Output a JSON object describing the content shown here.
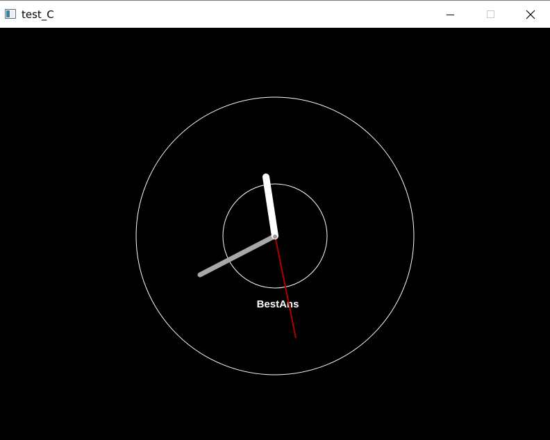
{
  "window": {
    "title": "test_C"
  },
  "title_controls": {
    "minimize_icon": "minimize-icon",
    "maximize_icon": "maximize-icon",
    "close_icon": "close-icon"
  },
  "clock": {
    "label": "BestAns",
    "colors": {
      "background": "#000000",
      "dial": "#ffffff",
      "hour_hand": "#ffffff",
      "minute_hand": "#a8a8a8",
      "second_hand": "#b00000",
      "center": "#9a9a9a"
    }
  }
}
